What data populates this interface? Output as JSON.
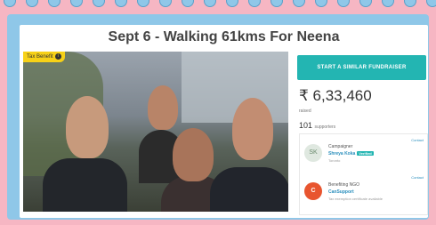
{
  "page": {
    "title": "Sept 6 - Walking 61kms For Neena"
  },
  "photo": {
    "badge_label": "Tax Benefit",
    "badge_icon": "info-icon"
  },
  "sidebar": {
    "cta_label": "START A SIMILAR FUNDRAISER",
    "amount": "₹ 6,33,460",
    "raised_label": "raised",
    "supporters_count": "101",
    "supporters_label": "supporters",
    "people": [
      {
        "avatar_initials": "SK",
        "role": "Campaigner",
        "name": "Shreya Koka",
        "verified_label": "Verified",
        "sub": "Toronto",
        "contact_label": "Contact"
      },
      {
        "avatar_initials": "C",
        "role": "Benefiting NGO",
        "name": "CanSupport",
        "verified_label": "",
        "sub": "Tax exemption certificate available",
        "contact_label": "Contact"
      }
    ]
  },
  "colors": {
    "background": "#f6b6c3",
    "frame": "#8fc7e8",
    "accent": "#23b5b2",
    "badge": "#f7d117",
    "link": "#2a8fbd"
  }
}
